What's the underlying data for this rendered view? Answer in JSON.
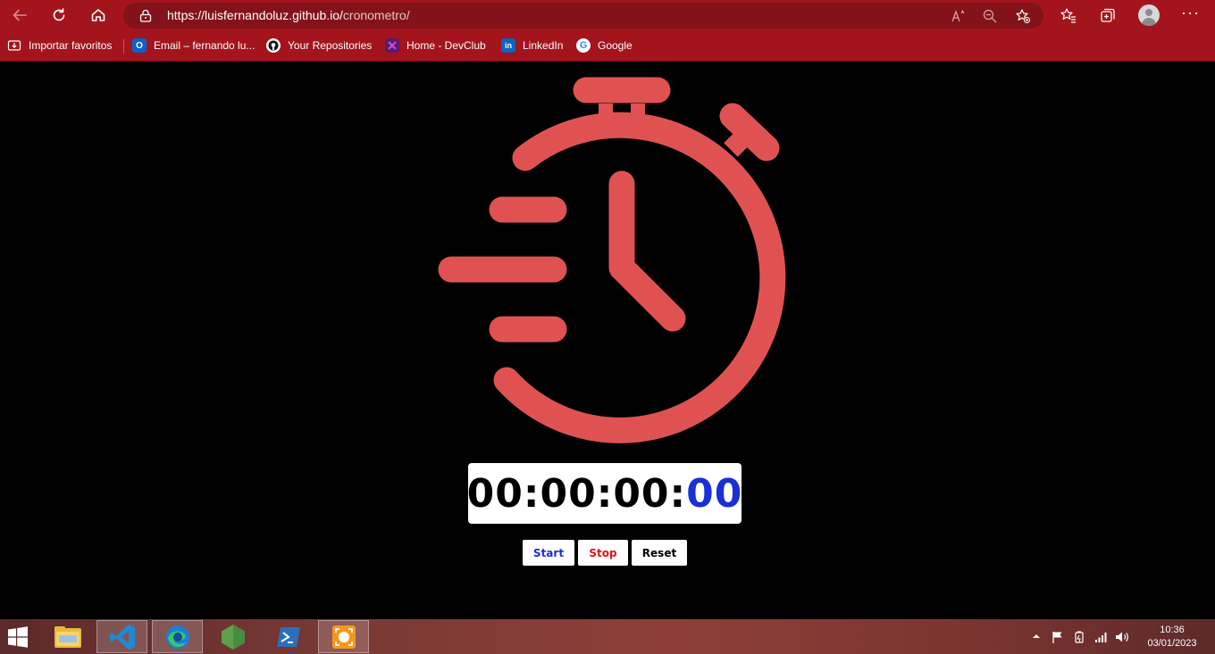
{
  "browser": {
    "url_host": "https://luisfernandoluz.github.io/",
    "url_path": "cronometro/"
  },
  "favorites": [
    {
      "label": "Importar favoritos",
      "icon": "import-icon"
    },
    {
      "label": "Email – fernando lu...",
      "icon": "outlook-icon"
    },
    {
      "label": "Your Repositories",
      "icon": "github-icon"
    },
    {
      "label": "Home - DevClub",
      "icon": "devclub-icon"
    },
    {
      "label": "LinkedIn",
      "icon": "linkedin-icon"
    },
    {
      "label": "Google",
      "icon": "google-icon"
    }
  ],
  "stopwatch": {
    "hours": "00",
    "minutes": "00",
    "seconds": "00",
    "milliseconds": "00",
    "separator": ":"
  },
  "controls": {
    "start": "Start",
    "stop": "Stop",
    "reset": "Reset"
  },
  "colors": {
    "icon": "#e05252",
    "start_text": "#1a2fd6",
    "stop_text": "#e0121a",
    "reset_text": "#000000",
    "milliseconds_text": "#1a2fd6",
    "browser_chrome": "#a3141c"
  },
  "taskbar": {
    "apps": [
      "start-menu-icon",
      "file-explorer-icon",
      "vscode-icon",
      "edge-icon",
      "nodejs-icon",
      "powershell-icon",
      "screen-recorder-icon"
    ],
    "time": "10:36",
    "date": "03/01/2023"
  }
}
